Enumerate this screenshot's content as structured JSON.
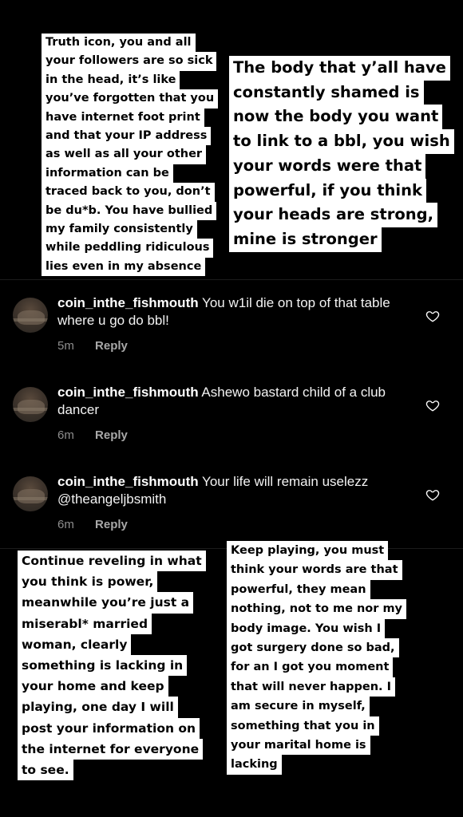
{
  "stories": {
    "top_left": [
      "Truth icon, you and all",
      "your followers are so sick",
      "in the head, it’s like",
      "you’ve forgotten that you",
      "have internet foot print",
      "and that your IP address",
      "as well as all your other",
      "information can be",
      "traced back to you, don’t",
      "be du*b. You have bullied",
      "my family consistently",
      "while peddling ridiculous",
      "lies even in my absence"
    ],
    "top_right": [
      "The body that y’all have",
      "constantly shamed is",
      "now the body you want",
      "to link to a bbl, you wish",
      "your words were that",
      "powerful, if you think",
      "your heads are strong,",
      "mine is stronger"
    ],
    "bottom_left": [
      "Continue reveling in what",
      "you think is power,",
      "meanwhile you’re just a",
      "miserabl* married",
      "woman, clearly",
      "something is lacking in",
      "your home and keep",
      "playing, one day I will",
      "post your information on",
      "the internet for everyone",
      "to see."
    ],
    "bottom_right": [
      "Keep playing, you must",
      "think your words are that",
      "powerful, they mean",
      "nothing, not to me nor my",
      "body image. You wish I",
      "got surgery done so bad,",
      "for an I got you moment",
      "that will never happen. I",
      "am secure in myself,",
      "something that you in",
      "your marital home is",
      "lacking"
    ]
  },
  "comments": [
    {
      "username": "coin_inthe_fishmouth",
      "text": "You w1il die on top of that table where u go do bbl!",
      "time": "5m",
      "reply_label": "Reply"
    },
    {
      "username": "coin_inthe_fishmouth",
      "text": "Ashewo bastard child of a club dancer",
      "time": "6m",
      "reply_label": "Reply"
    },
    {
      "username": "coin_inthe_fishmouth",
      "text": "Your life will remain uselezz @theangeljbsmith",
      "time": "6m",
      "reply_label": "Reply"
    }
  ],
  "icons": {
    "like": "heart-outline-icon",
    "avatar": "profile-avatar"
  },
  "colors": {
    "background": "#000000",
    "highlight": "#ffffff",
    "meta_text": "#8e8e8e"
  }
}
